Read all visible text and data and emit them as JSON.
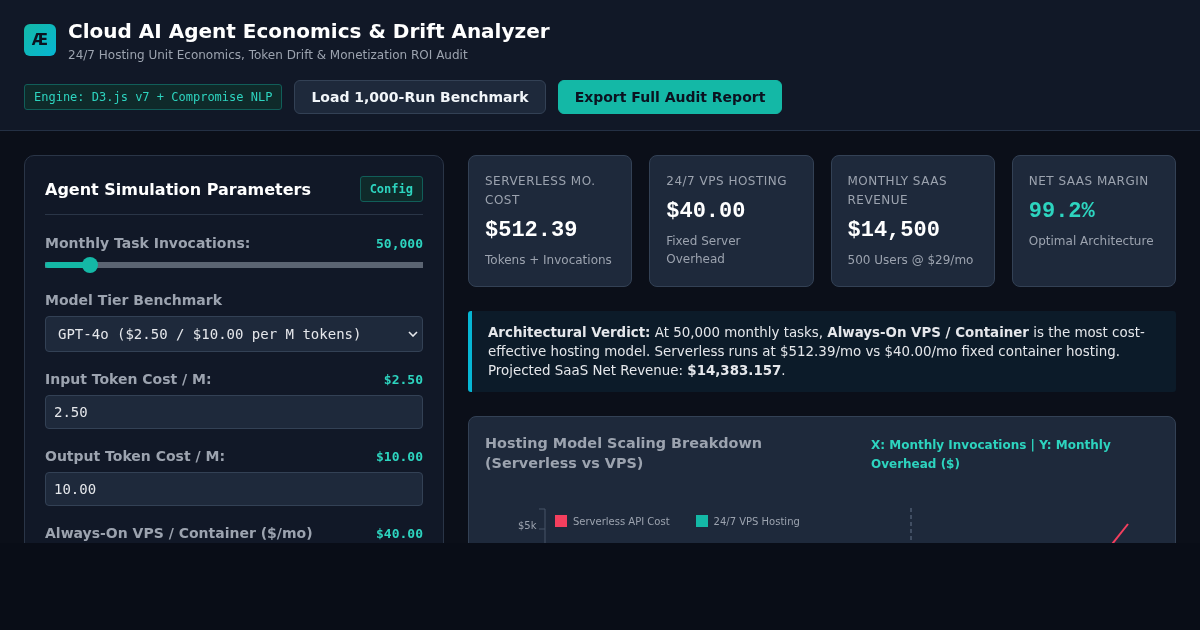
{
  "header": {
    "logo": "Æ",
    "title": "Cloud AI Agent Economics & Drift Analyzer",
    "subtitle": "24/7 Hosting Unit Economics, Token Drift & Monetization ROI Audit",
    "engine_badge": "Engine: D3.js v7 + Compromise NLP",
    "buttons": [
      {
        "label": "Load 1,000-Run Benchmark",
        "kind": "secondary"
      },
      {
        "label": "Export Full Audit Report",
        "kind": "primary"
      }
    ]
  },
  "parameters": {
    "title": "Agent Simulation Parameters",
    "badge": "Config",
    "fields": [
      {
        "kind": "slider",
        "label": "Monthly Task Invocations:",
        "reading": "50,000",
        "level": 0.12
      },
      {
        "kind": "select",
        "label": "Model Tier Benchmark",
        "value": "GPT-4o ($2.50 / $10.00 per M tokens)"
      },
      {
        "kind": "number",
        "label": "Input Token Cost / M:",
        "reading": "$2.50",
        "value": "2.50"
      },
      {
        "kind": "number",
        "label": "Output Token Cost / M:",
        "reading": "$10.00",
        "value": "10.00"
      },
      {
        "kind": "label",
        "label": "Always-On VPS / Container ($/mo)",
        "reading": "$40.00"
      }
    ]
  },
  "stats": [
    {
      "label": "SERVERLESS MO. COST",
      "value": "$512.39",
      "note": "Tokens + Invocations",
      "highlight": false
    },
    {
      "label": "24/7 VPS HOSTING",
      "value": "$40.00",
      "note": "Fixed Server Overhead",
      "highlight": false
    },
    {
      "label": "MONTHLY SAAS REVENUE",
      "value": "$14,500",
      "note": "500 Users @ $29/mo",
      "highlight": false
    },
    {
      "label": "NET SAAS MARGIN",
      "value": "99.2%",
      "note": "Optimal Architecture",
      "highlight": true
    }
  ],
  "verdict": "**Architectural Verdict:** At 50,000 monthly tasks, **Always-On VPS / Container** is the most cost-effective hosting model. Serverless runs at $512.39/mo vs $40.00/mo fixed container hosting. Projected SaaS Net Revenue: **$14,383.157**.",
  "chart": {
    "title": "Hosting Model Scaling Breakdown (Serverless vs VPS)",
    "axes_note": "X: Monthly Invocations | Y: Monthly Overhead ($)",
    "y_tick": "$5k",
    "legend": [
      {
        "name": "Serverless API Cost",
        "color": "#f43f5e"
      },
      {
        "name": "24/7 VPS Hosting",
        "color": "#14b8a6"
      }
    ]
  }
}
